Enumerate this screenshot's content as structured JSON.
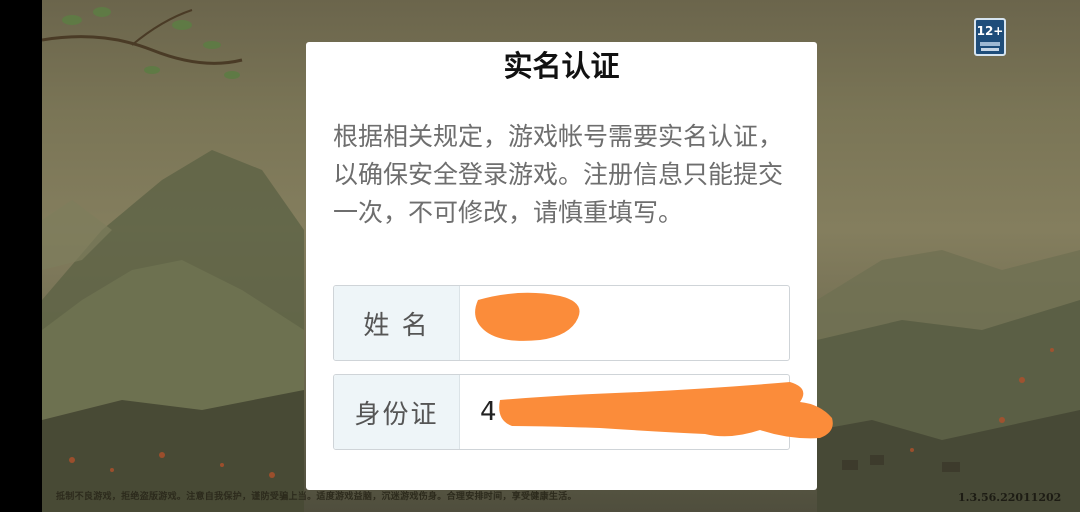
{
  "background": {
    "footer_notice": "抵制不良游戏，拒绝盗版游戏。注意自我保护，谨防受骗上当。适度游戏益脑，沉迷游戏伤身。合理安排时间，享受健康生活。",
    "version": "1.3.56.22011202",
    "age_rating": {
      "label": "12+"
    }
  },
  "dialog": {
    "title": "实名认证",
    "description": "根据相关规定，游戏帐号需要实名认证，以确保安全登录游戏。注册信息只能提交一次，不可修改，请慎重填写。",
    "fields": {
      "name": {
        "label": "姓 名",
        "value": ""
      },
      "id_card": {
        "label": "身份证",
        "value": "4"
      }
    }
  },
  "colors": {
    "redaction": "#fb8c3a",
    "label_bg": "#eef5f8"
  }
}
